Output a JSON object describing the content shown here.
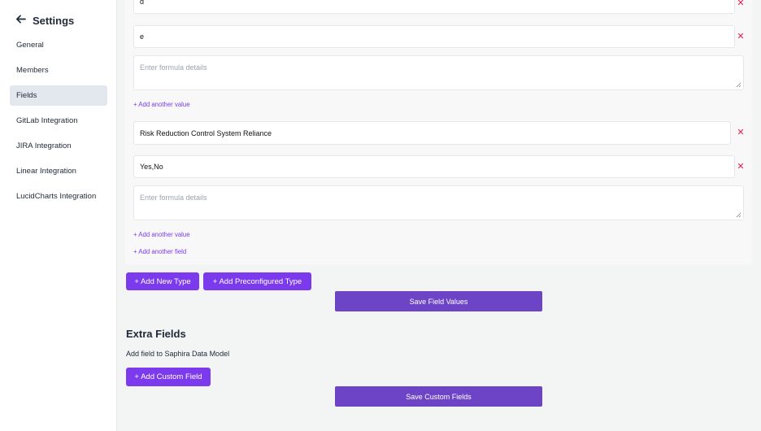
{
  "sidebar": {
    "title": "Settings",
    "items": [
      {
        "label": "General"
      },
      {
        "label": "Members"
      },
      {
        "label": "Fields"
      },
      {
        "label": "GitLab Integration"
      },
      {
        "label": "JIRA Integration"
      },
      {
        "label": "Linear Integration"
      },
      {
        "label": "LucidCharts Integration"
      }
    ],
    "active": "Fields"
  },
  "fields": {
    "value_d": "d",
    "value_e": "e",
    "formula_placeholder": "Enter formula details",
    "add_value_label": "+ Add another value",
    "field_name": "Risk Reduction Control System Reliance",
    "field_values": "Yes,No",
    "add_field_label": "+ Add another field"
  },
  "actions": {
    "add_new_type": "+ Add New Type",
    "add_preconfigured_type": "+ Add Preconfigured Type",
    "save_field_values": "Save Field Values"
  },
  "extra_fields": {
    "title": "Extra Fields",
    "description": "Add field to Saphira Data Model",
    "add_custom_field": "+ Add Custom Field",
    "save_custom_fields": "Save Custom Fields"
  },
  "colors": {
    "accent": "#7c3aed",
    "save_button": "#6d44c6",
    "remove_icon": "#e11d48",
    "active_nav": "#e3e7ee"
  }
}
